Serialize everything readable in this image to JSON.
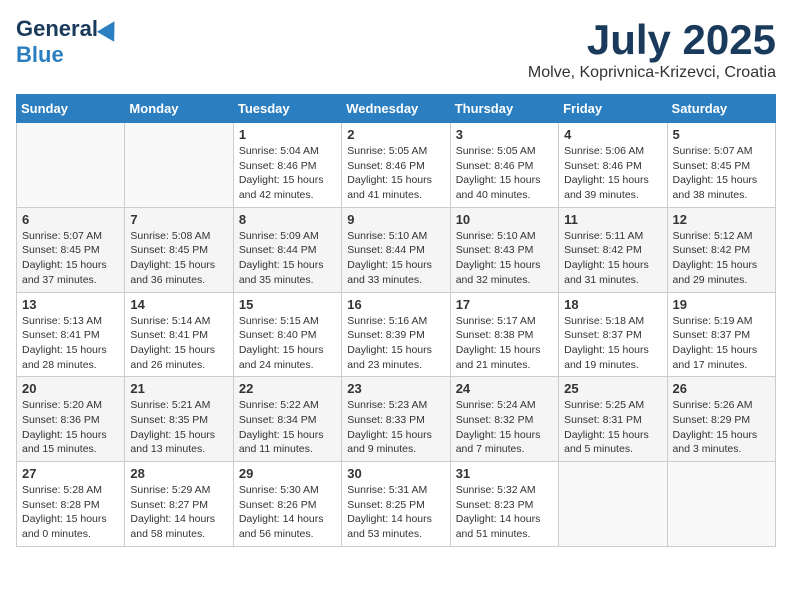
{
  "header": {
    "logo_general": "General",
    "logo_blue": "Blue",
    "title": "July 2025",
    "location": "Molve, Koprivnica-Krizevci, Croatia"
  },
  "weekdays": [
    "Sunday",
    "Monday",
    "Tuesday",
    "Wednesday",
    "Thursday",
    "Friday",
    "Saturday"
  ],
  "weeks": [
    [
      {
        "day": "",
        "info": ""
      },
      {
        "day": "",
        "info": ""
      },
      {
        "day": "1",
        "info": "Sunrise: 5:04 AM\nSunset: 8:46 PM\nDaylight: 15 hours\nand 42 minutes."
      },
      {
        "day": "2",
        "info": "Sunrise: 5:05 AM\nSunset: 8:46 PM\nDaylight: 15 hours\nand 41 minutes."
      },
      {
        "day": "3",
        "info": "Sunrise: 5:05 AM\nSunset: 8:46 PM\nDaylight: 15 hours\nand 40 minutes."
      },
      {
        "day": "4",
        "info": "Sunrise: 5:06 AM\nSunset: 8:46 PM\nDaylight: 15 hours\nand 39 minutes."
      },
      {
        "day": "5",
        "info": "Sunrise: 5:07 AM\nSunset: 8:45 PM\nDaylight: 15 hours\nand 38 minutes."
      }
    ],
    [
      {
        "day": "6",
        "info": "Sunrise: 5:07 AM\nSunset: 8:45 PM\nDaylight: 15 hours\nand 37 minutes."
      },
      {
        "day": "7",
        "info": "Sunrise: 5:08 AM\nSunset: 8:45 PM\nDaylight: 15 hours\nand 36 minutes."
      },
      {
        "day": "8",
        "info": "Sunrise: 5:09 AM\nSunset: 8:44 PM\nDaylight: 15 hours\nand 35 minutes."
      },
      {
        "day": "9",
        "info": "Sunrise: 5:10 AM\nSunset: 8:44 PM\nDaylight: 15 hours\nand 33 minutes."
      },
      {
        "day": "10",
        "info": "Sunrise: 5:10 AM\nSunset: 8:43 PM\nDaylight: 15 hours\nand 32 minutes."
      },
      {
        "day": "11",
        "info": "Sunrise: 5:11 AM\nSunset: 8:42 PM\nDaylight: 15 hours\nand 31 minutes."
      },
      {
        "day": "12",
        "info": "Sunrise: 5:12 AM\nSunset: 8:42 PM\nDaylight: 15 hours\nand 29 minutes."
      }
    ],
    [
      {
        "day": "13",
        "info": "Sunrise: 5:13 AM\nSunset: 8:41 PM\nDaylight: 15 hours\nand 28 minutes."
      },
      {
        "day": "14",
        "info": "Sunrise: 5:14 AM\nSunset: 8:41 PM\nDaylight: 15 hours\nand 26 minutes."
      },
      {
        "day": "15",
        "info": "Sunrise: 5:15 AM\nSunset: 8:40 PM\nDaylight: 15 hours\nand 24 minutes."
      },
      {
        "day": "16",
        "info": "Sunrise: 5:16 AM\nSunset: 8:39 PM\nDaylight: 15 hours\nand 23 minutes."
      },
      {
        "day": "17",
        "info": "Sunrise: 5:17 AM\nSunset: 8:38 PM\nDaylight: 15 hours\nand 21 minutes."
      },
      {
        "day": "18",
        "info": "Sunrise: 5:18 AM\nSunset: 8:37 PM\nDaylight: 15 hours\nand 19 minutes."
      },
      {
        "day": "19",
        "info": "Sunrise: 5:19 AM\nSunset: 8:37 PM\nDaylight: 15 hours\nand 17 minutes."
      }
    ],
    [
      {
        "day": "20",
        "info": "Sunrise: 5:20 AM\nSunset: 8:36 PM\nDaylight: 15 hours\nand 15 minutes."
      },
      {
        "day": "21",
        "info": "Sunrise: 5:21 AM\nSunset: 8:35 PM\nDaylight: 15 hours\nand 13 minutes."
      },
      {
        "day": "22",
        "info": "Sunrise: 5:22 AM\nSunset: 8:34 PM\nDaylight: 15 hours\nand 11 minutes."
      },
      {
        "day": "23",
        "info": "Sunrise: 5:23 AM\nSunset: 8:33 PM\nDaylight: 15 hours\nand 9 minutes."
      },
      {
        "day": "24",
        "info": "Sunrise: 5:24 AM\nSunset: 8:32 PM\nDaylight: 15 hours\nand 7 minutes."
      },
      {
        "day": "25",
        "info": "Sunrise: 5:25 AM\nSunset: 8:31 PM\nDaylight: 15 hours\nand 5 minutes."
      },
      {
        "day": "26",
        "info": "Sunrise: 5:26 AM\nSunset: 8:29 PM\nDaylight: 15 hours\nand 3 minutes."
      }
    ],
    [
      {
        "day": "27",
        "info": "Sunrise: 5:28 AM\nSunset: 8:28 PM\nDaylight: 15 hours\nand 0 minutes."
      },
      {
        "day": "28",
        "info": "Sunrise: 5:29 AM\nSunset: 8:27 PM\nDaylight: 14 hours\nand 58 minutes."
      },
      {
        "day": "29",
        "info": "Sunrise: 5:30 AM\nSunset: 8:26 PM\nDaylight: 14 hours\nand 56 minutes."
      },
      {
        "day": "30",
        "info": "Sunrise: 5:31 AM\nSunset: 8:25 PM\nDaylight: 14 hours\nand 53 minutes."
      },
      {
        "day": "31",
        "info": "Sunrise: 5:32 AM\nSunset: 8:23 PM\nDaylight: 14 hours\nand 51 minutes."
      },
      {
        "day": "",
        "info": ""
      },
      {
        "day": "",
        "info": ""
      }
    ]
  ],
  "row_shades": [
    false,
    true,
    false,
    true,
    false
  ]
}
